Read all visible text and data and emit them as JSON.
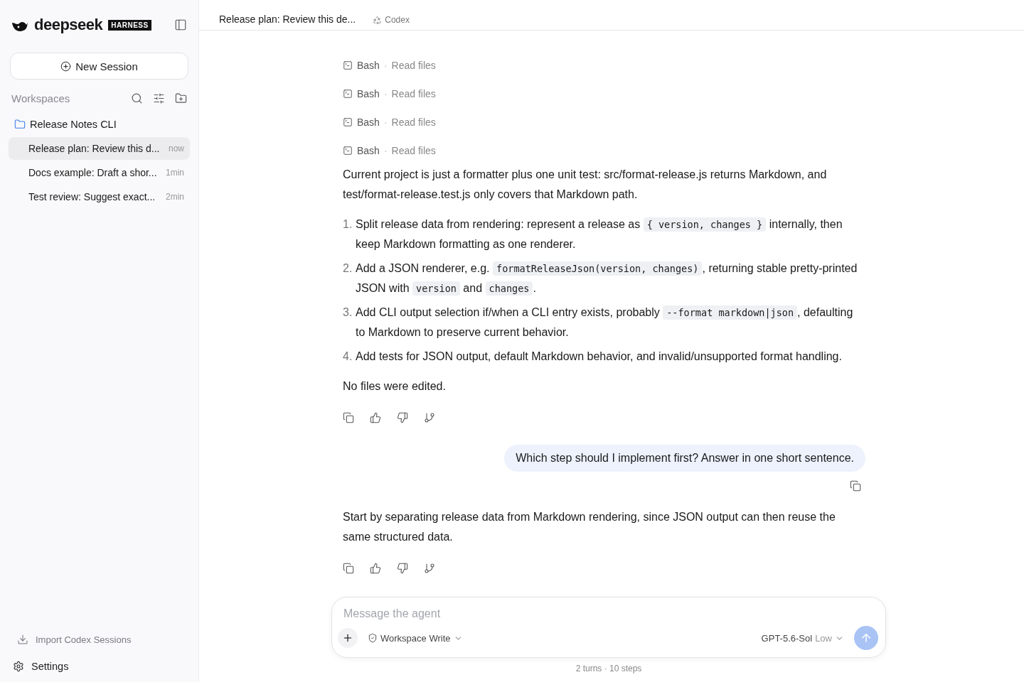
{
  "sidebar": {
    "brand": "deepseek",
    "badge": "HARNESS",
    "new_session": "New Session",
    "workspaces_label": "Workspaces",
    "workspace": {
      "name": "Release Notes CLI",
      "sessions": [
        {
          "title": "Release plan: Review this d...",
          "time": "now",
          "selected": true
        },
        {
          "title": "Docs example: Draft a shor...",
          "time": "1min",
          "selected": false
        },
        {
          "title": "Test review: Suggest exact...",
          "time": "2min",
          "selected": false
        }
      ]
    },
    "import": "Import Codex Sessions",
    "settings": "Settings"
  },
  "header": {
    "title": "Release plan: Review this de...",
    "agent": "Codex"
  },
  "conversation": [
    {
      "kind": "tool",
      "tool": "Bash",
      "action": "Read files"
    },
    {
      "kind": "tool",
      "tool": "Bash",
      "action": "Read files"
    },
    {
      "kind": "tool",
      "tool": "Bash",
      "action": "Read files"
    },
    {
      "kind": "tool",
      "tool": "Bash",
      "action": "Read files"
    },
    {
      "kind": "text",
      "text": "Current project is just a formatter plus one unit test: src/format-release.js returns Markdown, and test/format-release.test.js only covers that Markdown path."
    },
    {
      "kind": "list",
      "markers": [
        "1.",
        "2.",
        "3.",
        "4."
      ],
      "items": [
        [
          {
            "kind": "text",
            "text": "Split release data from rendering: represent a release as "
          },
          {
            "kind": "code",
            "text": "{ version, changes }"
          },
          {
            "kind": "text",
            "text": " internally, then keep Markdown formatting as one renderer."
          }
        ],
        [
          {
            "kind": "text",
            "text": "Add a JSON renderer, e.g. "
          },
          {
            "kind": "code",
            "text": "formatReleaseJson(version, changes)"
          },
          {
            "kind": "text",
            "text": ", returning stable pretty-printed JSON with "
          },
          {
            "kind": "code",
            "text": "version"
          },
          {
            "kind": "text",
            "text": " and "
          },
          {
            "kind": "code",
            "text": "changes"
          },
          {
            "kind": "text",
            "text": "."
          }
        ],
        [
          {
            "kind": "text",
            "text": "Add CLI output selection if/when a CLI entry exists, probably "
          },
          {
            "kind": "code",
            "text": "--format markdown|json"
          },
          {
            "kind": "text",
            "text": ", defaulting to Markdown to preserve current behavior."
          }
        ],
        [
          {
            "kind": "text",
            "text": "Add tests for JSON output, default Markdown behavior, and invalid/unsupported format handling."
          }
        ]
      ]
    },
    {
      "kind": "text",
      "text": "No files were edited."
    },
    {
      "kind": "actions"
    },
    {
      "kind": "user",
      "text": "Which step should I implement first? Answer in one short sentence."
    },
    {
      "kind": "text",
      "text": "Start by separating release data from Markdown rendering, since JSON output can then reuse the same structured data."
    },
    {
      "kind": "actions"
    }
  ],
  "tool_separator": "·",
  "composer": {
    "placeholder": "Message the agent",
    "permission": "Workspace Write",
    "model": "GPT-5.6-Sol",
    "effort": "Low"
  },
  "footer": "2 turns · 10 steps"
}
